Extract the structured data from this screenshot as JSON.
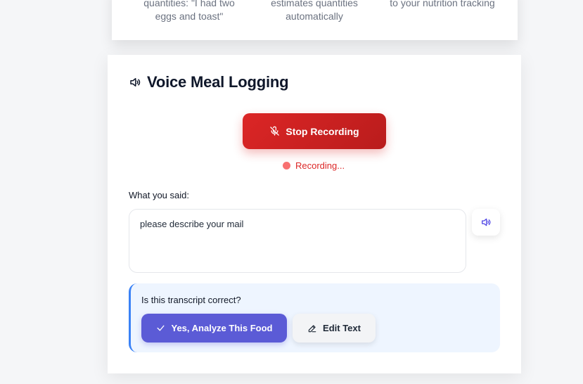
{
  "top_card": {
    "col1": "quantities: \"I had two eggs and toast\"",
    "col2": "estimates quantities automatically",
    "col3": "to your nutrition tracking"
  },
  "voice_logging": {
    "title": "Voice Meal Logging",
    "title_icon": "speaker-icon",
    "stop_button": {
      "label": "Stop Recording",
      "icon": "mic-off-icon"
    },
    "status": "Recording...",
    "transcript_label": "What you said:",
    "transcript_value": "please describe your mail",
    "speak_button_icon": "speaker-icon",
    "confirm": {
      "question": "Is this transcript correct?",
      "yes_label": "Yes, Analyze This Food",
      "yes_icon": "check-icon",
      "edit_label": "Edit Text",
      "edit_icon": "pencil-icon"
    }
  },
  "colors": {
    "recording_red": "#dc2626",
    "primary_indigo": "#5b5bd6",
    "confirm_bg": "#eef5ff",
    "confirm_border": "#3b82f6"
  }
}
